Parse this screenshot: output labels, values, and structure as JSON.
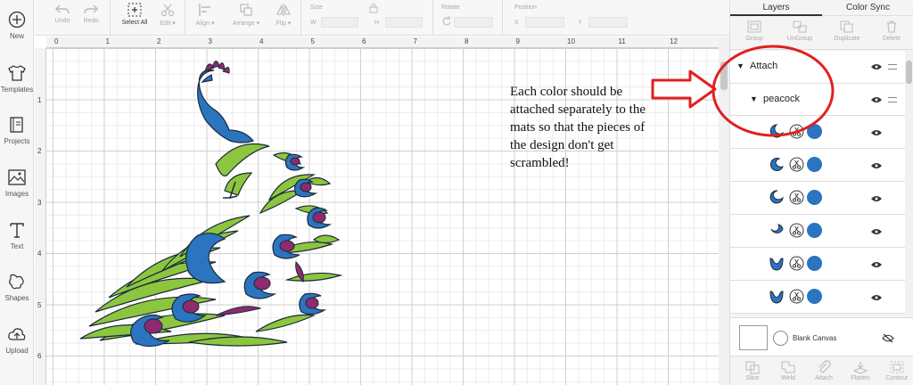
{
  "sidebar": {
    "items": [
      {
        "label": "New",
        "icon": "plus-circle-icon"
      },
      {
        "label": "Templates",
        "icon": "tshirt-icon"
      },
      {
        "label": "Projects",
        "icon": "projects-icon"
      },
      {
        "label": "Images",
        "icon": "image-icon"
      },
      {
        "label": "Text",
        "icon": "text-icon"
      },
      {
        "label": "Shapes",
        "icon": "shapes-icon"
      },
      {
        "label": "Upload",
        "icon": "cloud-upload-icon"
      }
    ]
  },
  "toolbar": {
    "undo": "Undo",
    "redo": "Redo",
    "select_all": "Select All",
    "edit": "Edit",
    "align": "Align",
    "arrange": "Arrange",
    "flip": "Flip",
    "size": "Size",
    "w": "W",
    "h": "H",
    "rotate": "Rotate",
    "position": "Position",
    "x": "X",
    "y": "Y"
  },
  "ruler": {
    "top": [
      "0",
      "1",
      "2",
      "3",
      "4",
      "5",
      "6",
      "7",
      "8",
      "9",
      "10",
      "11",
      "12"
    ],
    "left": [
      "1",
      "2",
      "3",
      "4",
      "5",
      "6"
    ]
  },
  "annotation": "Each color should be attached separately to the mats so that the pieces of the design don't get scrambled!",
  "panel": {
    "tabs": [
      "Layers",
      "Color Sync"
    ],
    "tools": [
      "Group",
      "UnGroup",
      "Duplicate",
      "Delete"
    ],
    "group_attach": "Attach",
    "group_peacock": "peacock",
    "layer_color": "#2a74c0",
    "layers_count": 6,
    "blank_canvas": "Blank Canvas",
    "bottom_tools": [
      "Slice",
      "Weld",
      "Attach",
      "Flatten",
      "Contour"
    ]
  },
  "colors": {
    "blue": "#2a74c0",
    "green": "#8cc63f",
    "purple": "#8e2a6e",
    "annotation_red": "#e02020"
  }
}
